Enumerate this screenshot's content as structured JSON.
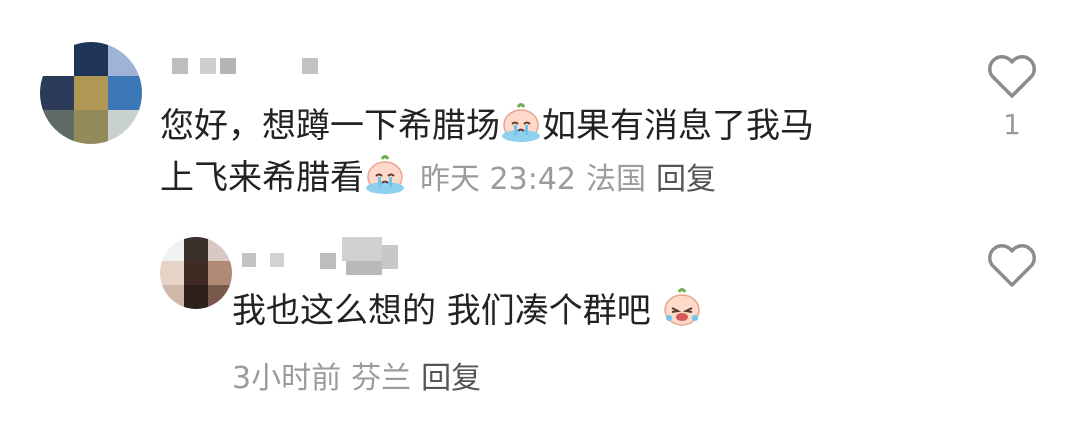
{
  "comments": [
    {
      "text_line1": "您好，想蹲一下希腊场",
      "text_line1b": "如果有消息了我马",
      "text_line2": "上飞来希腊看",
      "time": "昨天 23:42",
      "location": "法国",
      "reply_label": "回复",
      "like_count": "1",
      "emoji": "crying-face-emoji"
    },
    {
      "text": "我也这么想的 我们凑个群吧",
      "time": "3小时前",
      "location": "芬兰",
      "reply_label": "回复",
      "emoji": "crying-face-emoji"
    }
  ],
  "icons": {
    "like": "heart-outline-icon"
  },
  "colors": {
    "text": "#222222",
    "meta": "#9b9b9b",
    "icon": "#8c8c8c"
  }
}
